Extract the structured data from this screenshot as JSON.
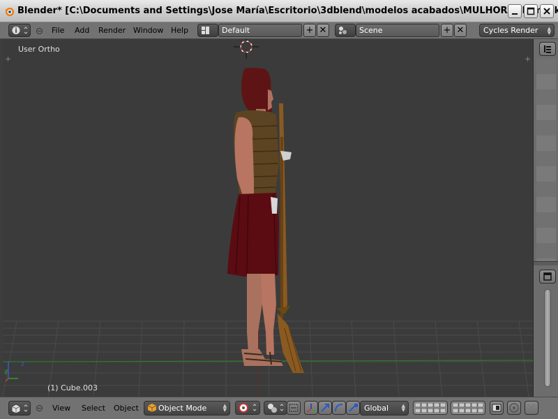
{
  "window": {
    "title": "Blender* [C:\\Documents and Settings\\Jose María\\Escritorio\\3dblend\\modelos acabados\\MULHORAND\\musketee..."
  },
  "info_header": {
    "menus": [
      "File",
      "Add",
      "Render",
      "Window",
      "Help"
    ],
    "screen_layout": "Default",
    "scene": "Scene",
    "render_engine": "Cycles Render"
  },
  "viewport": {
    "view_label": "User Ortho",
    "object_label": "(1) Cube.003"
  },
  "view3d_header": {
    "menus": [
      "View",
      "Select",
      "Object"
    ],
    "mode": "Object Mode",
    "orientation": "Global"
  },
  "colors": {
    "viewport_bg": "#3b3b3b",
    "header_bg": "#727272",
    "x_axis": "#6a2a2a",
    "y_axis": "#2e7a2e",
    "grid": "#4a4a4a"
  },
  "icons": [
    "blender-logo-icon",
    "info-editor-icon",
    "screen-layout-icon",
    "scene-icon",
    "view3d-editor-icon",
    "cursor-icon",
    "pivot-icon",
    "manipulator-icon",
    "layers-icon",
    "render-icon",
    "properties-icon",
    "outliner-icon"
  ]
}
